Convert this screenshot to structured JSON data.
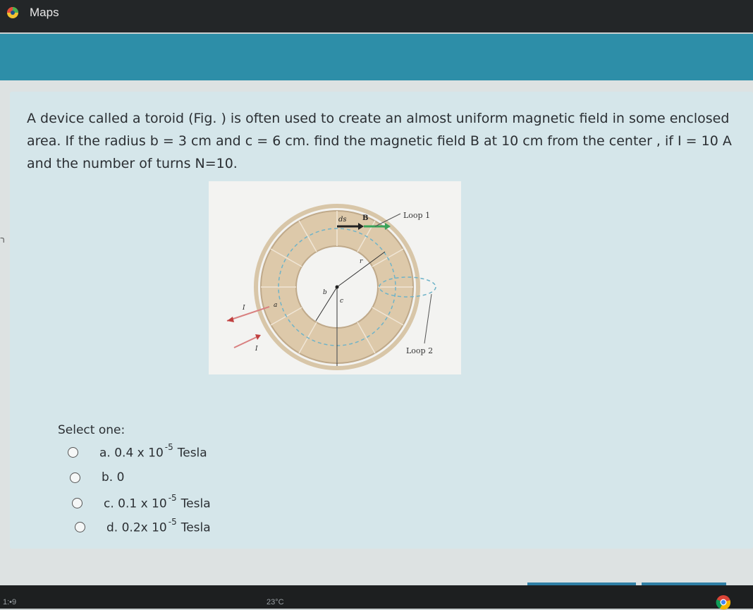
{
  "app": {
    "title": "Maps"
  },
  "left_edge": {
    "char": "ר"
  },
  "question": {
    "text": "A device called a toroid (Fig. ) is often used to create an almost uniform magnetic field in some enclosed area. If the radius b = 3 cm  and c = 6 cm. find the magnetic field B at 10 cm from the center , if  I = 10 A and the number of turns N=10."
  },
  "figure": {
    "labels": {
      "ds": "ds",
      "B": "B",
      "loop1": "Loop 1",
      "loop2": "Loop 2",
      "r": "r",
      "b": "b",
      "c": "c",
      "a": "a",
      "I1": "I",
      "I2": "I"
    }
  },
  "select_one": "Select one:",
  "options": [
    {
      "prefix": "a. 0.4 x 10",
      "exp": "-5",
      "suffix": "Tesla"
    },
    {
      "prefix": "b. 0",
      "exp": "",
      "suffix": ""
    },
    {
      "prefix": "c. 0.1 x 10",
      "exp": "-5",
      "suffix": "Tesla"
    },
    {
      "prefix": "d. 0.2x 10",
      "exp": "-5",
      "suffix": "Tesla"
    }
  ],
  "bottom": {
    "left_text": "1:•9",
    "temp_text": "23°C"
  }
}
